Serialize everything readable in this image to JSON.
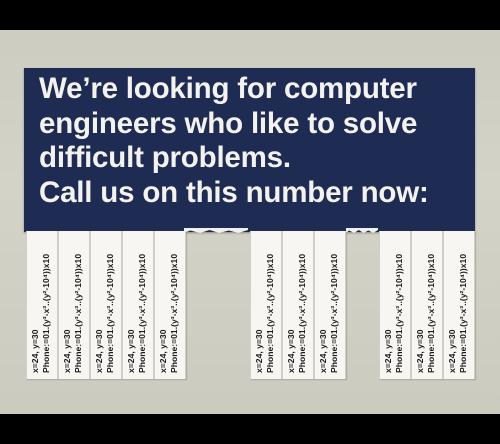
{
  "flyer": {
    "lines": [
      "We’re looking for computer",
      "engineers who like to solve",
      "difficult problems.",
      "Call us on this number now:"
    ]
  },
  "tab": {
    "coords": "x=24, y=30",
    "phone": "Phone:=01.(y³-x³..(y²-10⁴))x10"
  }
}
